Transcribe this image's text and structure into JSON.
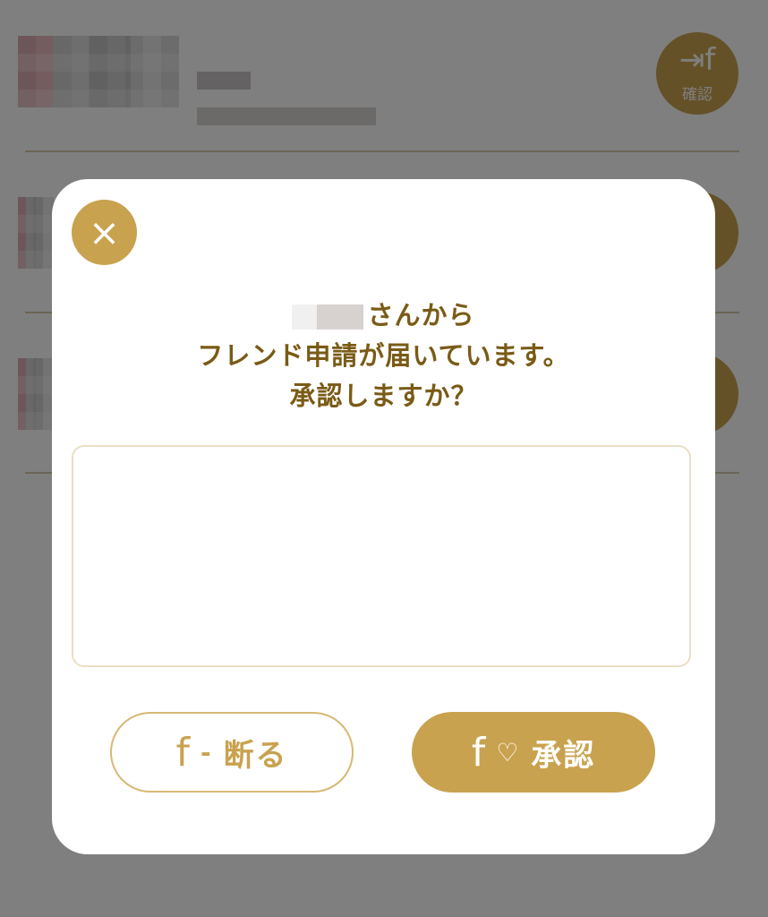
{
  "background": {
    "rows": [
      {
        "confirm_label": "確認",
        "confirm_glyph": "⇥f"
      },
      {
        "confirm_label": "",
        "confirm_glyph": ""
      },
      {
        "confirm_label": "",
        "confirm_glyph": ""
      }
    ]
  },
  "modal": {
    "close_icon": "×",
    "message": {
      "line1_suffix": "さんから",
      "line2": "フレンド申請が届いています。",
      "line3": "承認しますか？"
    },
    "textarea": {
      "value": "",
      "placeholder": ""
    },
    "decline": {
      "glyph": "f",
      "mark": "-",
      "label": "断る"
    },
    "accept": {
      "glyph": "f",
      "mark": "♡",
      "label": "承認"
    }
  },
  "colors": {
    "accent": "#c9a24f",
    "text": "#7a5b16",
    "overlay": "rgba(0,0,0,0.5)"
  }
}
